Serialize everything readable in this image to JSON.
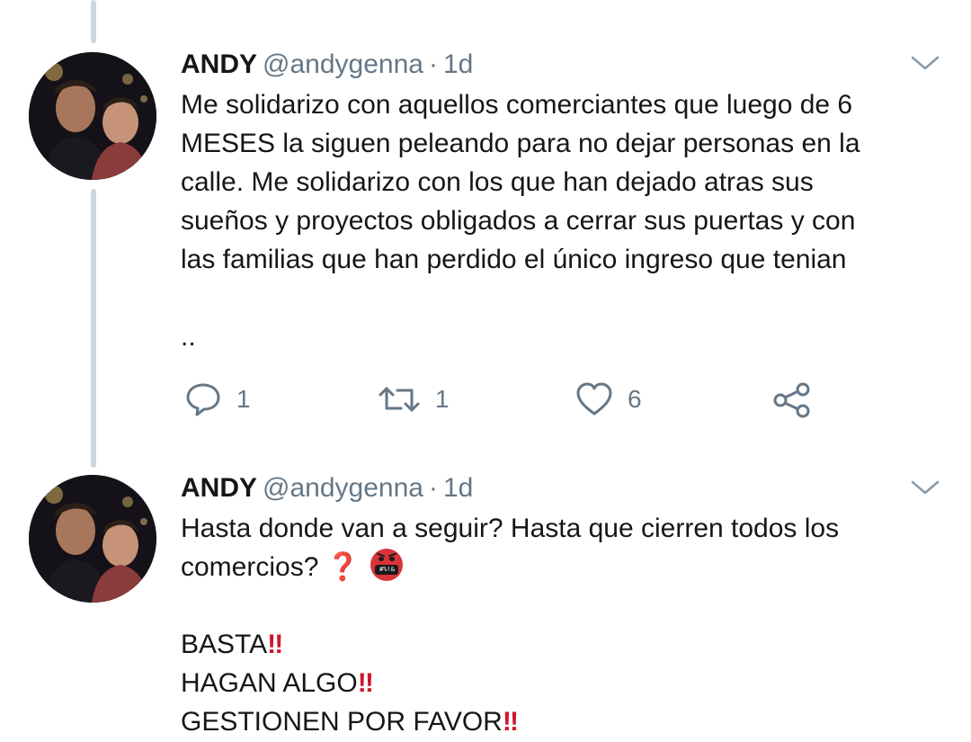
{
  "tweets": [
    {
      "name": "ANDY",
      "handle": "@andygenna",
      "separator": "·",
      "time": "1d",
      "lines": [
        "Me solidarizo con aquellos comerciantes que luego de 6",
        "MESES la siguen peleando para no dejar personas en la",
        "calle. Me solidarizo con los que han dejado atras sus",
        "sueños y proyectos obligados a cerrar sus puertas y con",
        "las familias que han perdido el único ingreso que tenian"
      ],
      "trailing": "..",
      "actions": {
        "reply_count": "1",
        "retweet_count": "1",
        "like_count": "6"
      }
    },
    {
      "name": "ANDY",
      "handle": "@andygenna",
      "separator": "·",
      "time": "1d",
      "line1": "Hasta donde van a seguir? Hasta que cierren todos los",
      "line2": "comercios?",
      "question_emoji": "❓",
      "cursing_emoji_text": "#%!&",
      "lines_after": [
        {
          "text": "BASTA",
          "emoji": "‼"
        },
        {
          "text": "HAGAN ALGO",
          "emoji": "‼"
        },
        {
          "text": "GESTIONEN POR FAVOR",
          "emoji": "‼"
        }
      ]
    }
  ],
  "icons": {
    "reply": "reply-icon",
    "retweet": "retweet-icon",
    "like": "heart-icon",
    "share": "share-icon",
    "more": "chevron-down-icon"
  },
  "colors": {
    "text": "#14171a",
    "secondary": "#657786",
    "thread_line": "#ccd6dd",
    "emoji_red": "#d0162e"
  }
}
